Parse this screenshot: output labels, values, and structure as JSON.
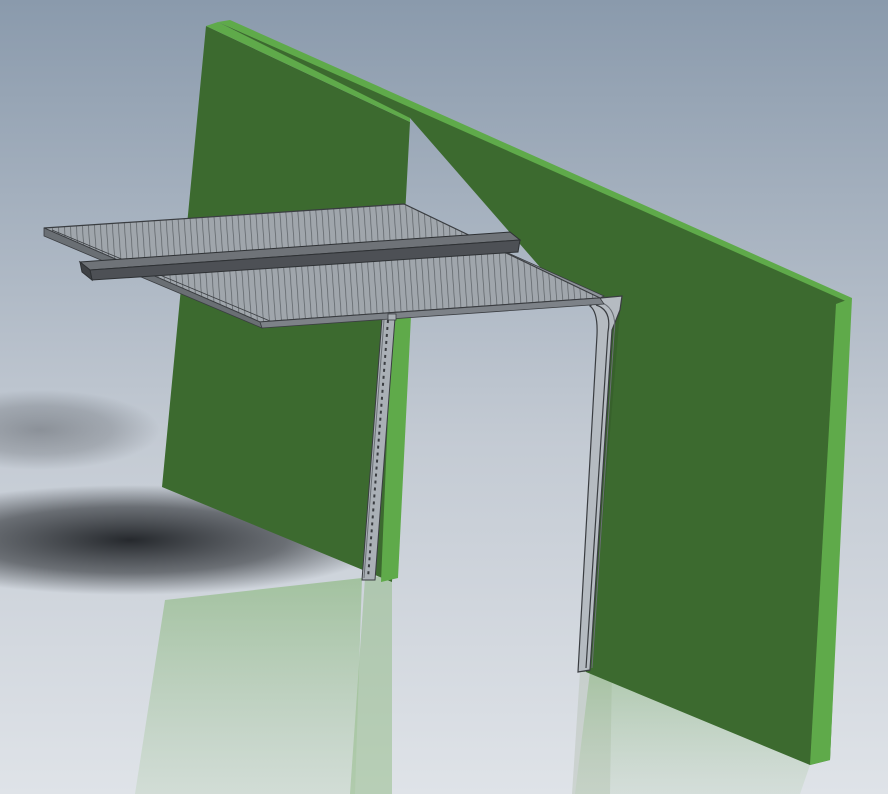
{
  "viewport": {
    "background_top": "#8a9aac",
    "background_bottom": "#dfe3e8",
    "floor": "#c9ced6",
    "shadow": "#1d2024"
  },
  "wall": {
    "face_color": "#3c6a2f",
    "edge_color": "#5faa4a"
  },
  "door_panel": {
    "color": "#9aa0a6",
    "rib_color": "#585d62"
  },
  "track": {
    "color": "#aab0b6",
    "outline_color": "#3a3d41"
  },
  "header_beam": {
    "color": "#5e6166"
  }
}
